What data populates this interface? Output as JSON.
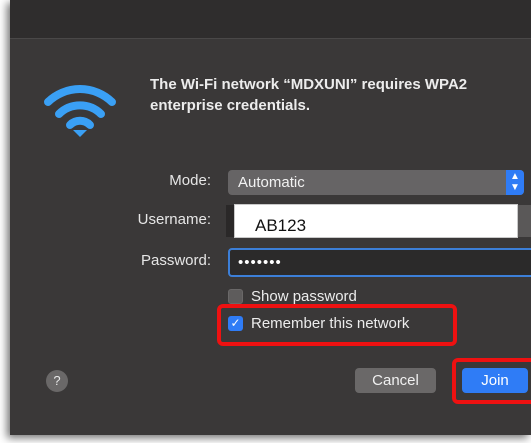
{
  "dialog": {
    "message": "The Wi-Fi network “MDXUNI” requires WPA2 enterprise credentials.",
    "icon": "wifi-icon"
  },
  "form": {
    "mode_label": "Mode:",
    "mode_value": "Automatic",
    "username_label": "Username:",
    "username_value": "AB123",
    "password_label": "Password:",
    "password_value": "•••••••"
  },
  "options": {
    "show_password_label": "Show password",
    "show_password_checked": false,
    "remember_network_label": "Remember this network",
    "remember_network_checked": true
  },
  "buttons": {
    "help_label": "?",
    "cancel_label": "Cancel",
    "join_label": "Join"
  },
  "colors": {
    "dialog_bg": "#3a3838",
    "accent_blue": "#2f7cf6",
    "highlight_red": "#ee1111"
  }
}
